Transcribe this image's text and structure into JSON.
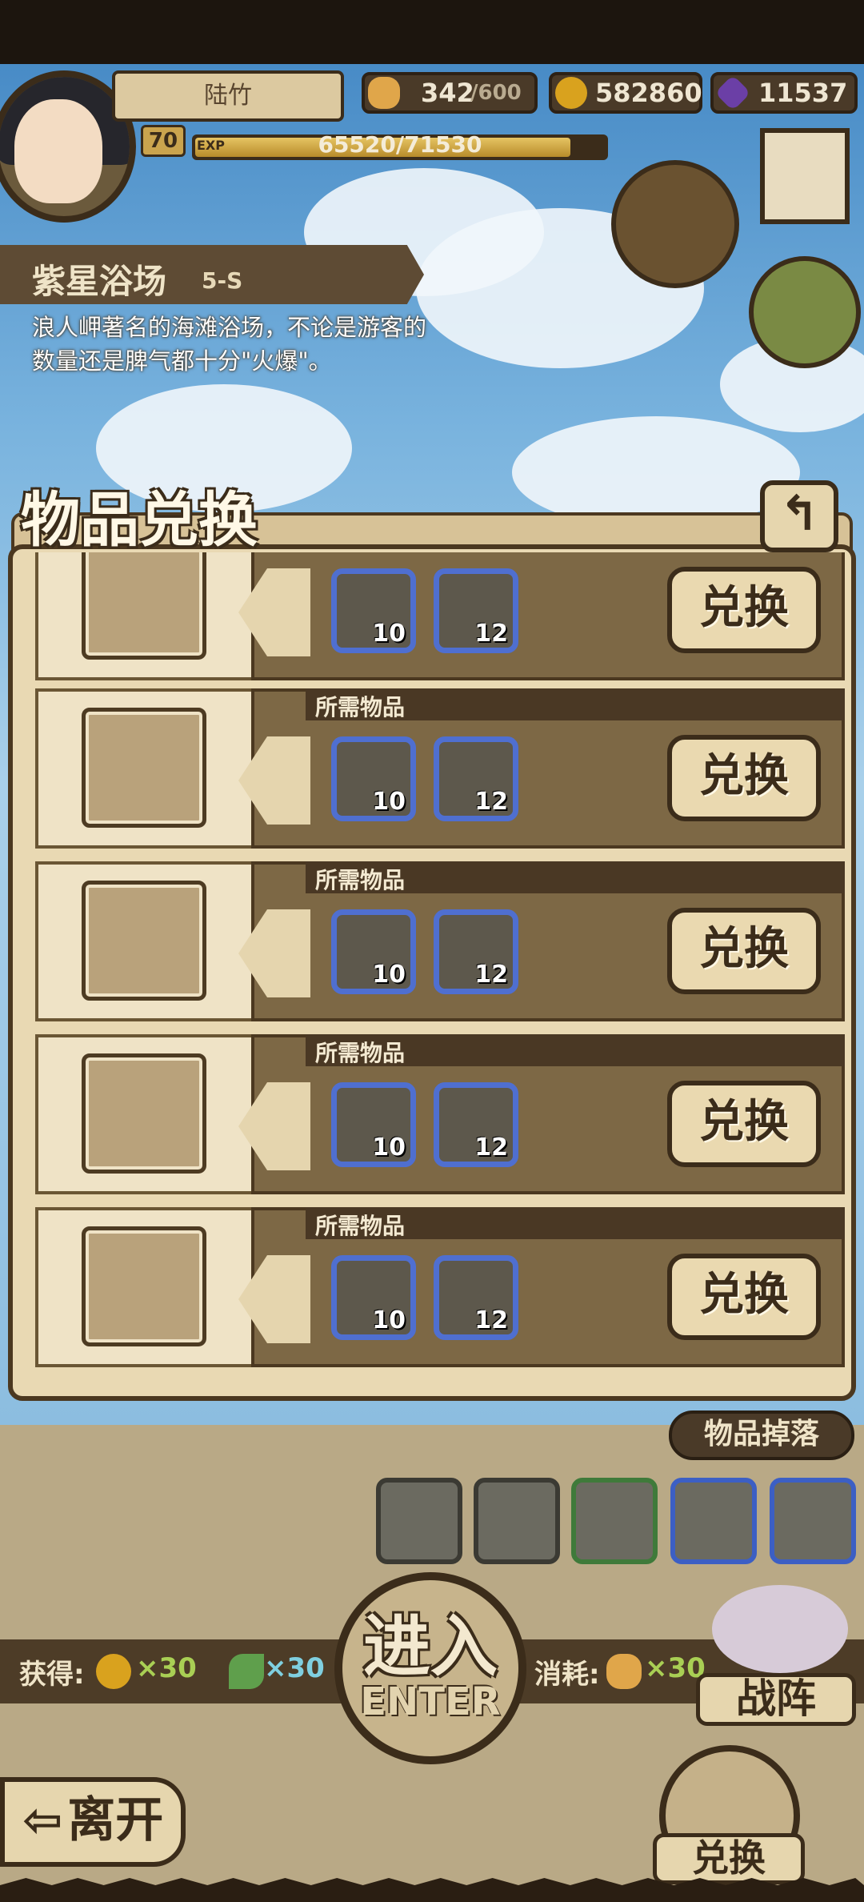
{
  "player": {
    "name": "陆竹",
    "level": "70",
    "exp_tag": "EXP",
    "exp_text": "65520/71530",
    "exp_fraction": 0.916,
    "stamina": "342",
    "stamina_max": "/600",
    "gold": "582860",
    "gems": "11537"
  },
  "stage": {
    "title": "紫星浴场",
    "code": "5-S",
    "description": "浪人岬著名的海滩浴场，不论是游客的数量还是脾气都十分\"火爆\"。"
  },
  "exchange": {
    "title": "物品兑换",
    "back_icon": "back-arrow-icon",
    "required_label": "所需物品",
    "button_label": "兑换",
    "rows": [
      {
        "item_icon": "sunglasses-icon",
        "materials": [
          {
            "icon": "stone-icon",
            "count": "10"
          },
          {
            "icon": "bottle-icon",
            "count": "12"
          }
        ]
      },
      {
        "item_icon": "flower-hairpin-icon",
        "materials": [
          {
            "icon": "stone-icon",
            "count": "10"
          },
          {
            "icon": "bottle-icon",
            "count": "12"
          }
        ]
      },
      {
        "item_icon": "fishing-rod-icon",
        "materials": [
          {
            "icon": "stone-icon",
            "count": "10"
          },
          {
            "icon": "bottle-icon",
            "count": "12"
          }
        ]
      },
      {
        "item_icon": "water-gun-icon",
        "materials": [
          {
            "icon": "stone-icon",
            "count": "10"
          },
          {
            "icon": "bottle-icon",
            "count": "12"
          }
        ]
      },
      {
        "item_icon": "small-water-gun-icon",
        "materials": [
          {
            "icon": "stone-icon",
            "count": "10"
          },
          {
            "icon": "bottle-icon",
            "count": "12"
          }
        ]
      }
    ]
  },
  "drops": {
    "label": "物品掉落",
    "items": [
      "blue-slime-icon",
      "orange-slime-icon",
      "chest-icon",
      "ghost-icon",
      "ore-icon"
    ]
  },
  "rewards": {
    "gain_label": "获得:",
    "gold_amount": "×30",
    "feather_amount": "×30",
    "cost_label": "消耗:",
    "cost_amount": "×30"
  },
  "buttons": {
    "enter_cn": "进入",
    "enter_en": "ENTER",
    "team": "战阵",
    "leave": "离开",
    "exchange": "兑换"
  },
  "colors": {
    "material_border": "#4f6fd0",
    "gold_coin": "#d9a21e",
    "gem": "#6b3fa6"
  }
}
